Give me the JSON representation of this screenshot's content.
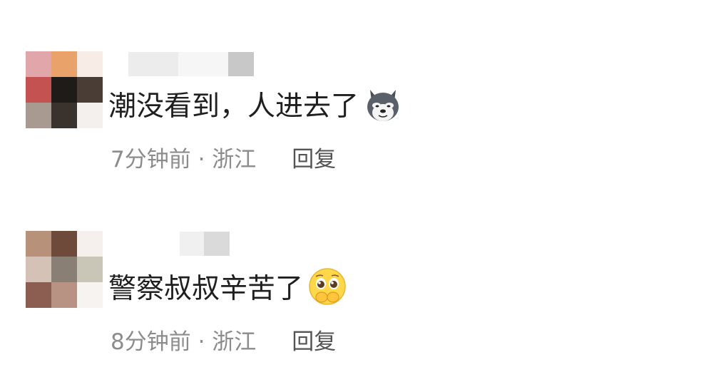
{
  "comments": [
    {
      "text": "潮没看到，人进去了",
      "emoji_icon": "doge-dog-emoji-icon",
      "time": "7分钟前 · 浙江",
      "reply_label": "回复",
      "avatar_colors": [
        "#e0a6a9",
        "#e9a26a",
        "#f7ece6",
        "#c45250",
        "#1f1b19",
        "#4a3d35",
        "#a89a90",
        "#3a322d",
        "#f3f0ee"
      ],
      "username_colors": [
        "#ececec",
        "#f6f6f6",
        "#c8c8c8"
      ]
    },
    {
      "text": "警察叔叔辛苦了",
      "emoji_icon": "pleading-face-emoji-icon",
      "time": "8分钟前 · 浙江",
      "reply_label": "回复",
      "avatar_colors": [
        "#b7917a",
        "#6e4a3a",
        "#f5f0ee",
        "#d4c2b6",
        "#8a7f74",
        "#c9c6b8",
        "#8c5e52",
        "#b89282",
        "#f6f3f1"
      ],
      "username_colors": [
        "#f0f0f0",
        "#dadada"
      ]
    }
  ]
}
